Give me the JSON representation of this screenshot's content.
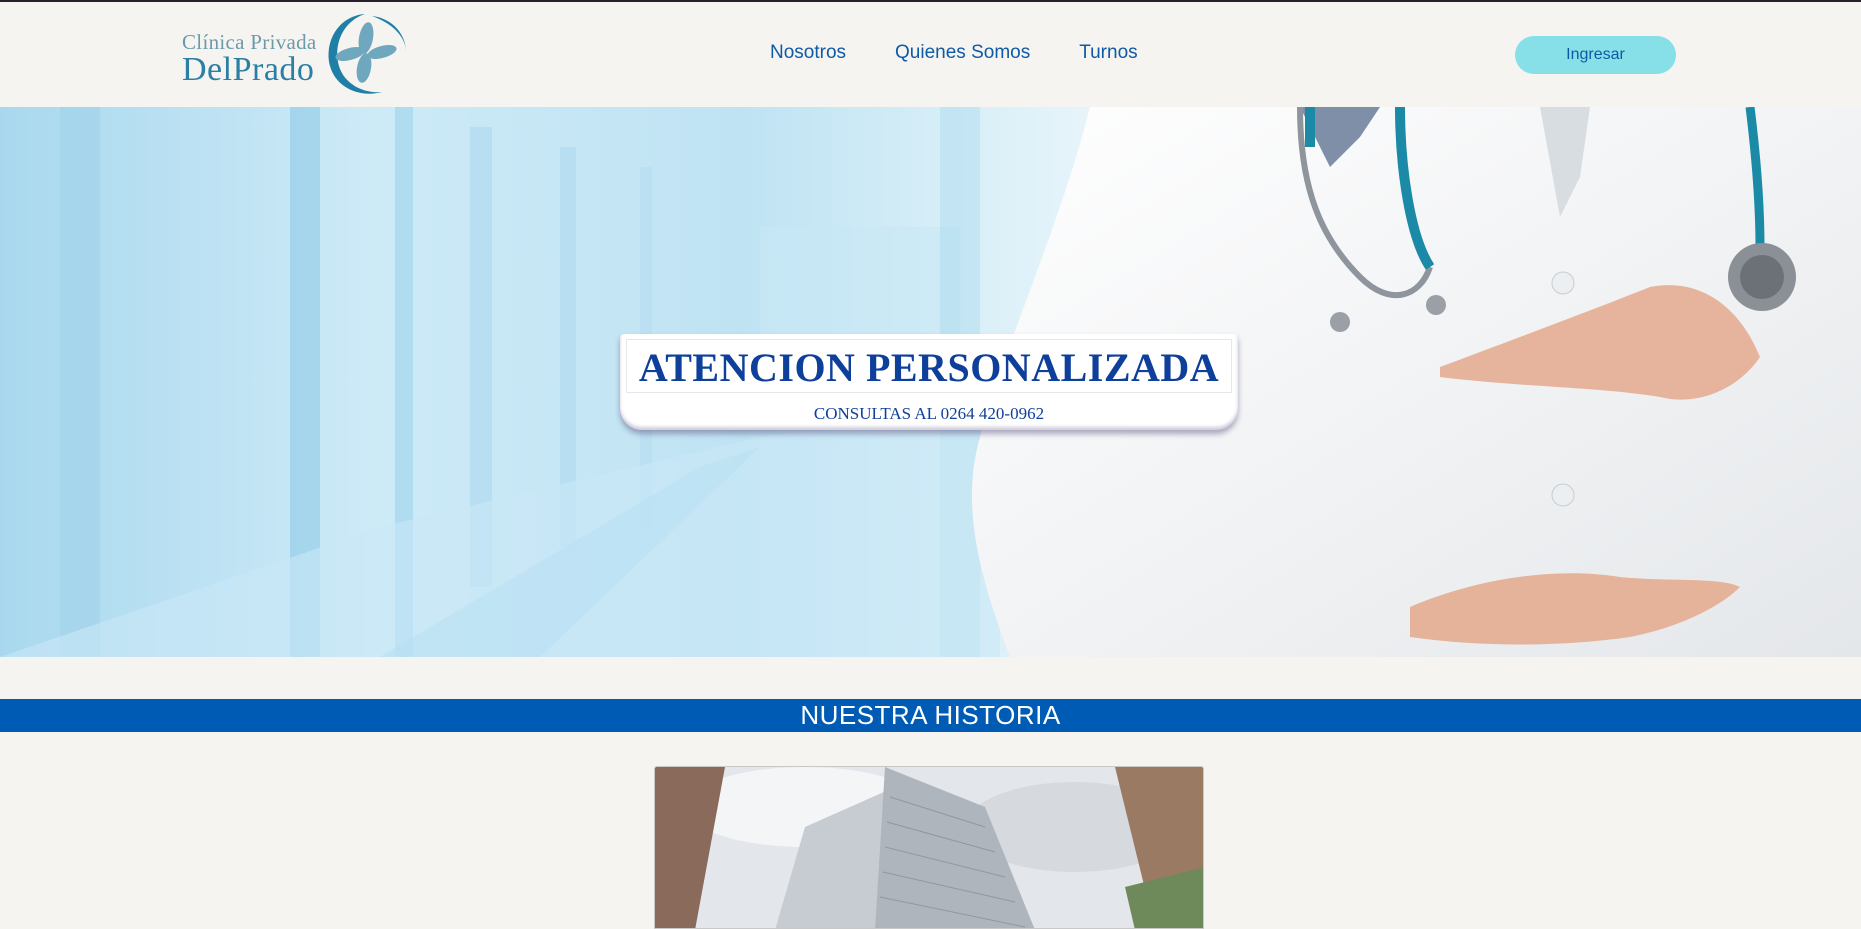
{
  "header": {
    "logo": {
      "line1": "Clínica Privada",
      "line2": "DelPrado",
      "icon": "clover-circle-logo"
    },
    "nav": [
      {
        "label": "Nosotros"
      },
      {
        "label": "Quienes Somos"
      },
      {
        "label": "Turnos"
      }
    ],
    "login_label": "Ingresar"
  },
  "hero": {
    "title": "ATENCION PERSONALIZADA",
    "subtitle": "CONSULTAS AL 0264 420-0962"
  },
  "section": {
    "title": "NUESTRA HISTORIA"
  },
  "colors": {
    "brand_blue": "#0f5aa5",
    "banner_blue": "#005bb5",
    "login_button": "#87dfe8",
    "background": "#f5f4f1"
  }
}
